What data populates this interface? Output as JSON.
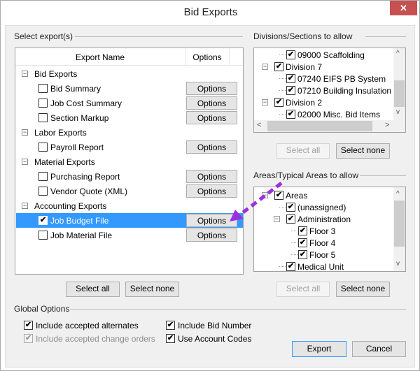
{
  "window": {
    "title": "Bid Exports",
    "close_icon": "close-icon"
  },
  "exports": {
    "group_label": "Select export(s)",
    "columns": [
      "Export Name",
      "Options"
    ],
    "rows": [
      {
        "type": "group",
        "label": "Bid Exports"
      },
      {
        "type": "item",
        "label": "Bid Summary",
        "checked": false,
        "options": "Options"
      },
      {
        "type": "item",
        "label": "Job Cost Summary",
        "checked": false,
        "options": "Options"
      },
      {
        "type": "item",
        "label": "Section Markup",
        "checked": false,
        "options": "Options"
      },
      {
        "type": "group",
        "label": "Labor Exports"
      },
      {
        "type": "item",
        "label": "Payroll Report",
        "checked": false,
        "options": "Options"
      },
      {
        "type": "group",
        "label": "Material Exports"
      },
      {
        "type": "item",
        "label": "Purchasing Report",
        "checked": false,
        "options": "Options"
      },
      {
        "type": "item",
        "label": "Vendor Quote (XML)",
        "checked": false,
        "options": "Options"
      },
      {
        "type": "group",
        "label": "Accounting Exports"
      },
      {
        "type": "item",
        "label": "Job Budget File",
        "checked": true,
        "selected": true,
        "options": "Options"
      },
      {
        "type": "item",
        "label": "Job Material File",
        "checked": false,
        "options": "Options"
      }
    ],
    "select_all": "Select all",
    "select_none": "Select none"
  },
  "divisions": {
    "group_label": "Divisions/Sections to allow",
    "items": [
      {
        "label": "09000 Scaffolding",
        "level": 2,
        "checked": true
      },
      {
        "label": "Division 7",
        "level": 1,
        "checked": true,
        "expander": "-"
      },
      {
        "label": "07240 EIFS PB System",
        "level": 2,
        "checked": true
      },
      {
        "label": "07210 Building Insulation",
        "level": 2,
        "checked": true
      },
      {
        "label": "Division 2",
        "level": 1,
        "checked": true,
        "expander": "-"
      },
      {
        "label": "02000 Misc. Bid Items",
        "level": 2,
        "checked": true
      }
    ],
    "select_all": "Select all",
    "select_none": "Select none"
  },
  "areas": {
    "group_label": "Areas/Typical Areas to allow",
    "items": [
      {
        "label": "Areas",
        "level": 1,
        "checked": true,
        "expander": "-"
      },
      {
        "label": "(unassigned)",
        "level": 2,
        "checked": true
      },
      {
        "label": "Administration",
        "level": 2,
        "checked": true,
        "expander": "-"
      },
      {
        "label": "Floor 3",
        "level": 3,
        "checked": true
      },
      {
        "label": "Floor 4",
        "level": 3,
        "checked": true
      },
      {
        "label": "Floor 5",
        "level": 3,
        "checked": true
      },
      {
        "label": "Medical Unit",
        "level": 2,
        "checked": true
      }
    ],
    "select_all": "Select all",
    "select_none": "Select none"
  },
  "global": {
    "group_label": "Global Options",
    "include_alternates": {
      "label": "Include accepted alternates",
      "checked": true
    },
    "include_change_orders": {
      "label": "Include accepted change orders",
      "checked": true,
      "disabled": true
    },
    "include_bid_number": {
      "label": "Include Bid Number",
      "checked": true
    },
    "use_account_codes": {
      "label": "Use Account Codes",
      "checked": true
    }
  },
  "footer": {
    "export": "Export",
    "cancel": "Cancel"
  },
  "annotation": {
    "arrow_color": "#9b30e0"
  }
}
